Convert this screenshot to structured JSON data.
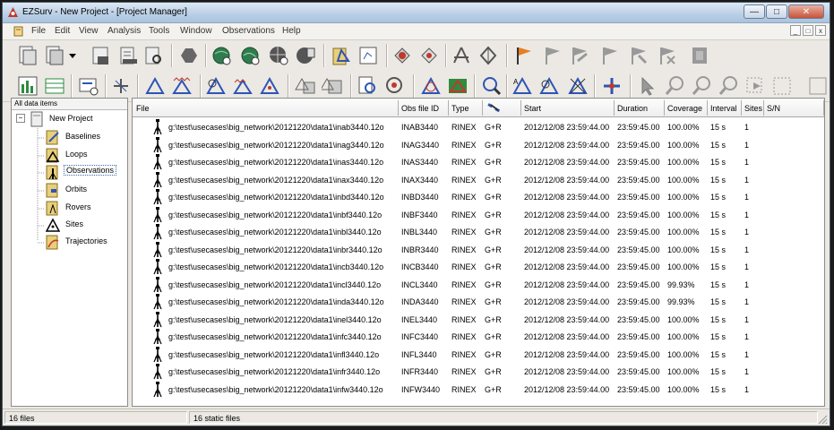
{
  "window": {
    "title": "EZSurv - New Project - [Project Manager]"
  },
  "menu": [
    "File",
    "Edit",
    "View",
    "Analysis",
    "Tools",
    "Window",
    "Observations",
    "Help"
  ],
  "tree": {
    "header": "All data items",
    "root": "New Project",
    "items": [
      "Baselines",
      "Loops",
      "Observations",
      "Orbits",
      "Rovers",
      "Sites",
      "Trajectories"
    ],
    "selected": "Observations"
  },
  "table": {
    "columns": [
      "File",
      "Obs file ID",
      "Type",
      "",
      "Start",
      "Duration",
      "Coverage",
      "Interval",
      "Sites",
      "S/N"
    ],
    "rows": [
      {
        "file": "g:\\test\\usecases\\big_network\\20121220\\data1\\inab3440.12o",
        "id": "INAB3440",
        "type": "RINEX",
        "sys": "G+R",
        "start": "2012/12/08 23:59:44.00",
        "duration": "23:59:45.00",
        "coverage": "100.00%",
        "interval": "15 s",
        "sites": "1"
      },
      {
        "file": "g:\\test\\usecases\\big_network\\20121220\\data1\\inag3440.12o",
        "id": "INAG3440",
        "type": "RINEX",
        "sys": "G+R",
        "start": "2012/12/08 23:59:44.00",
        "duration": "23:59:45.00",
        "coverage": "100.00%",
        "interval": "15 s",
        "sites": "1"
      },
      {
        "file": "g:\\test\\usecases\\big_network\\20121220\\data1\\inas3440.12o",
        "id": "INAS3440",
        "type": "RINEX",
        "sys": "G+R",
        "start": "2012/12/08 23:59:44.00",
        "duration": "23:59:45.00",
        "coverage": "100.00%",
        "interval": "15 s",
        "sites": "1"
      },
      {
        "file": "g:\\test\\usecases\\big_network\\20121220\\data1\\inax3440.12o",
        "id": "INAX3440",
        "type": "RINEX",
        "sys": "G+R",
        "start": "2012/12/08 23:59:44.00",
        "duration": "23:59:45.00",
        "coverage": "100.00%",
        "interval": "15 s",
        "sites": "1"
      },
      {
        "file": "g:\\test\\usecases\\big_network\\20121220\\data1\\inbd3440.12o",
        "id": "INBD3440",
        "type": "RINEX",
        "sys": "G+R",
        "start": "2012/12/08 23:59:44.00",
        "duration": "23:59:45.00",
        "coverage": "100.00%",
        "interval": "15 s",
        "sites": "1"
      },
      {
        "file": "g:\\test\\usecases\\big_network\\20121220\\data1\\inbf3440.12o",
        "id": "INBF3440",
        "type": "RINEX",
        "sys": "G+R",
        "start": "2012/12/08 23:59:44.00",
        "duration": "23:59:45.00",
        "coverage": "100.00%",
        "interval": "15 s",
        "sites": "1"
      },
      {
        "file": "g:\\test\\usecases\\big_network\\20121220\\data1\\inbl3440.12o",
        "id": "INBL3440",
        "type": "RINEX",
        "sys": "G+R",
        "start": "2012/12/08 23:59:44.00",
        "duration": "23:59:45.00",
        "coverage": "100.00%",
        "interval": "15 s",
        "sites": "1"
      },
      {
        "file": "g:\\test\\usecases\\big_network\\20121220\\data1\\inbr3440.12o",
        "id": "INBR3440",
        "type": "RINEX",
        "sys": "G+R",
        "start": "2012/12/08 23:59:44.00",
        "duration": "23:59:45.00",
        "coverage": "100.00%",
        "interval": "15 s",
        "sites": "1"
      },
      {
        "file": "g:\\test\\usecases\\big_network\\20121220\\data1\\incb3440.12o",
        "id": "INCB3440",
        "type": "RINEX",
        "sys": "G+R",
        "start": "2012/12/08 23:59:44.00",
        "duration": "23:59:45.00",
        "coverage": "100.00%",
        "interval": "15 s",
        "sites": "1"
      },
      {
        "file": "g:\\test\\usecases\\big_network\\20121220\\data1\\incl3440.12o",
        "id": "INCL3440",
        "type": "RINEX",
        "sys": "G+R",
        "start": "2012/12/08 23:59:44.00",
        "duration": "23:59:45.00",
        "coverage": "99.93%",
        "interval": "15 s",
        "sites": "1"
      },
      {
        "file": "g:\\test\\usecases\\big_network\\20121220\\data1\\inda3440.12o",
        "id": "INDA3440",
        "type": "RINEX",
        "sys": "G+R",
        "start": "2012/12/08 23:59:44.00",
        "duration": "23:59:45.00",
        "coverage": "99.93%",
        "interval": "15 s",
        "sites": "1"
      },
      {
        "file": "g:\\test\\usecases\\big_network\\20121220\\data1\\inel3440.12o",
        "id": "INEL3440",
        "type": "RINEX",
        "sys": "G+R",
        "start": "2012/12/08 23:59:44.00",
        "duration": "23:59:45.00",
        "coverage": "100.00%",
        "interval": "15 s",
        "sites": "1"
      },
      {
        "file": "g:\\test\\usecases\\big_network\\20121220\\data1\\infc3440.12o",
        "id": "INFC3440",
        "type": "RINEX",
        "sys": "G+R",
        "start": "2012/12/08 23:59:44.00",
        "duration": "23:59:45.00",
        "coverage": "100.00%",
        "interval": "15 s",
        "sites": "1"
      },
      {
        "file": "g:\\test\\usecases\\big_network\\20121220\\data1\\infl3440.12o",
        "id": "INFL3440",
        "type": "RINEX",
        "sys": "G+R",
        "start": "2012/12/08 23:59:44.00",
        "duration": "23:59:45.00",
        "coverage": "100.00%",
        "interval": "15 s",
        "sites": "1"
      },
      {
        "file": "g:\\test\\usecases\\big_network\\20121220\\data1\\infr3440.12o",
        "id": "INFR3440",
        "type": "RINEX",
        "sys": "G+R",
        "start": "2012/12/08 23:59:44.00",
        "duration": "23:59:45.00",
        "coverage": "100.00%",
        "interval": "15 s",
        "sites": "1"
      },
      {
        "file": "g:\\test\\usecases\\big_network\\20121220\\data1\\infw3440.12o",
        "id": "INFW3440",
        "type": "RINEX",
        "sys": "G+R",
        "start": "2012/12/08 23:59:44.00",
        "duration": "23:59:45.00",
        "coverage": "100.00%",
        "interval": "15 s",
        "sites": "1"
      }
    ]
  },
  "status": {
    "left": "16 files",
    "right": "16 static files"
  }
}
